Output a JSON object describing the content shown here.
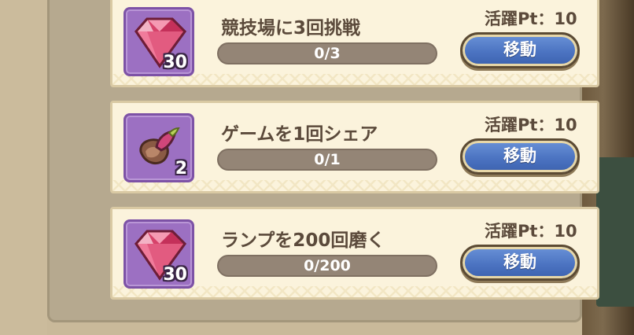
{
  "missions": [
    {
      "title": "競技場に3回挑戦",
      "points": "活躍Pt：10",
      "progress_text": "0/3",
      "progress": 0,
      "reward_icon": "ruby-gem-icon",
      "reward_count": "30",
      "button_label": "移動"
    },
    {
      "title": "ゲームを1回シェア",
      "points": "活躍Pt：10",
      "progress_text": "0/1",
      "progress": 0,
      "reward_icon": "seed-bud-icon",
      "reward_count": "2",
      "button_label": "移動"
    },
    {
      "title": "ランプを200回磨く",
      "points": "活躍Pt：10",
      "progress_text": "0/200",
      "progress": 0,
      "reward_icon": "ruby-gem-icon",
      "reward_count": "30",
      "button_label": "移動"
    }
  ],
  "colors": {
    "card_bg": "#fbf3dc",
    "icon_bg": "#9c70c2",
    "button": "#4c74c2",
    "progress_track": "#948576",
    "text": "#5b4a3b"
  }
}
